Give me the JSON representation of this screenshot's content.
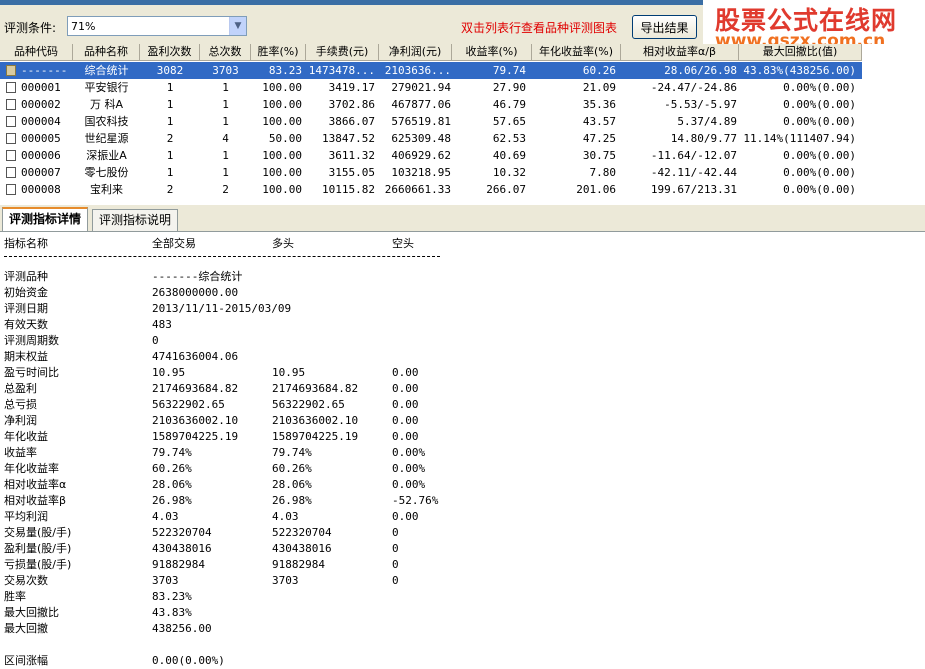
{
  "toolbar": {
    "condition_label": "评测条件:",
    "condition_value": "71%",
    "hint": "双击列表行查看品种评测图表",
    "export_label": "导出结果"
  },
  "logo": {
    "title": "股票公式在线网",
    "url": "www.gszx.com.cn"
  },
  "grid": {
    "columns": [
      "品种代码",
      "品种名称",
      "盈利次数",
      "总次数",
      "胜率(%)",
      "手续费(元)",
      "净利润(元)",
      "收益率(%)",
      "年化收益率(%)",
      "相对收益率α/β",
      "最大回撤比(值)"
    ],
    "rows": [
      {
        "code": "-------",
        "name": "综合统计",
        "wins": "3082",
        "total": "3703",
        "rate": "83.23",
        "fee": "1473478...",
        "profit": "2103636...",
        "ret": "79.74",
        "annual": "60.26",
        "rel": "28.06/26.98",
        "dd": "43.83%(438256.00)"
      },
      {
        "code": "000001",
        "name": "平安银行",
        "wins": "1",
        "total": "1",
        "rate": "100.00",
        "fee": "3419.17",
        "profit": "279021.94",
        "ret": "27.90",
        "annual": "21.09",
        "rel": "-24.47/-24.86",
        "dd": "0.00%(0.00)"
      },
      {
        "code": "000002",
        "name": "万 科A",
        "wins": "1",
        "total": "1",
        "rate": "100.00",
        "fee": "3702.86",
        "profit": "467877.06",
        "ret": "46.79",
        "annual": "35.36",
        "rel": "-5.53/-5.97",
        "dd": "0.00%(0.00)"
      },
      {
        "code": "000004",
        "name": "国农科技",
        "wins": "1",
        "total": "1",
        "rate": "100.00",
        "fee": "3866.07",
        "profit": "576519.81",
        "ret": "57.65",
        "annual": "43.57",
        "rel": "5.37/4.89",
        "dd": "0.00%(0.00)"
      },
      {
        "code": "000005",
        "name": "世纪星源",
        "wins": "2",
        "total": "4",
        "rate": "50.00",
        "fee": "13847.52",
        "profit": "625309.48",
        "ret": "62.53",
        "annual": "47.25",
        "rel": "14.80/9.77",
        "dd": "11.14%(111407.94)"
      },
      {
        "code": "000006",
        "name": "深振业A",
        "wins": "1",
        "total": "1",
        "rate": "100.00",
        "fee": "3611.32",
        "profit": "406929.62",
        "ret": "40.69",
        "annual": "30.75",
        "rel": "-11.64/-12.07",
        "dd": "0.00%(0.00)"
      },
      {
        "code": "000007",
        "name": "零七股份",
        "wins": "1",
        "total": "1",
        "rate": "100.00",
        "fee": "3155.05",
        "profit": "103218.95",
        "ret": "10.32",
        "annual": "7.80",
        "rel": "-42.11/-42.44",
        "dd": "0.00%(0.00)"
      },
      {
        "code": "000008",
        "name": "宝利来",
        "wins": "2",
        "total": "2",
        "rate": "100.00",
        "fee": "10115.82",
        "profit": "2660661.33",
        "ret": "266.07",
        "annual": "201.06",
        "rel": "199.67/213.31",
        "dd": "0.00%(0.00)"
      }
    ]
  },
  "tabs": [
    "评测指标详情",
    "评测指标说明"
  ],
  "detail": {
    "headers": [
      "指标名称",
      "全部交易",
      "多头",
      "空头"
    ],
    "rows": [
      {
        "k": "评测品种",
        "a": "-------综合统计",
        "b": "",
        "c": ""
      },
      {
        "k": "初始资金",
        "a": "2638000000.00",
        "b": "",
        "c": ""
      },
      {
        "k": "评测日期",
        "a": "2013/11/11-2015/03/09",
        "b": "",
        "c": ""
      },
      {
        "k": "有效天数",
        "a": "483",
        "b": "",
        "c": ""
      },
      {
        "k": "评测周期数",
        "a": "0",
        "b": "",
        "c": ""
      },
      {
        "k": "期末权益",
        "a": "4741636004.06",
        "b": "",
        "c": ""
      },
      {
        "k": "盈亏时间比",
        "a": "10.95",
        "b": "10.95",
        "c": "0.00"
      },
      {
        "k": "总盈利",
        "a": "2174693684.82",
        "b": "2174693684.82",
        "c": "0.00"
      },
      {
        "k": "总亏损",
        "a": "56322902.65",
        "b": "56322902.65",
        "c": "0.00"
      },
      {
        "k": "净利润",
        "a": "2103636002.10",
        "b": "2103636002.10",
        "c": "0.00"
      },
      {
        "k": "年化收益",
        "a": "1589704225.19",
        "b": "1589704225.19",
        "c": "0.00"
      },
      {
        "k": "收益率",
        "a": "79.74%",
        "b": "79.74%",
        "c": "0.00%"
      },
      {
        "k": "年化收益率",
        "a": "60.26%",
        "b": "60.26%",
        "c": "0.00%"
      },
      {
        "k": "相对收益率α",
        "a": "28.06%",
        "b": "28.06%",
        "c": "0.00%"
      },
      {
        "k": "相对收益率β",
        "a": "26.98%",
        "b": "26.98%",
        "c": "-52.76%"
      },
      {
        "k": "平均利润",
        "a": "4.03",
        "b": "4.03",
        "c": "0.00"
      },
      {
        "k": "交易量(股/手)",
        "a": "522320704",
        "b": "522320704",
        "c": "0"
      },
      {
        "k": "盈利量(股/手)",
        "a": "430438016",
        "b": "430438016",
        "c": "0"
      },
      {
        "k": "亏损量(股/手)",
        "a": "91882984",
        "b": "91882984",
        "c": "0"
      },
      {
        "k": "交易次数",
        "a": "3703",
        "b": "3703",
        "c": "0"
      },
      {
        "k": "胜率",
        "a": "83.23%",
        "b": "",
        "c": ""
      },
      {
        "k": "最大回撤比",
        "a": "43.83%",
        "b": "",
        "c": ""
      },
      {
        "k": "最大回撤",
        "a": "438256.00",
        "b": "",
        "c": ""
      },
      {
        "k": "",
        "a": "",
        "b": "",
        "c": ""
      },
      {
        "k": "区间涨幅",
        "a": "0.00(0.00%)",
        "b": "",
        "c": ""
      }
    ]
  }
}
